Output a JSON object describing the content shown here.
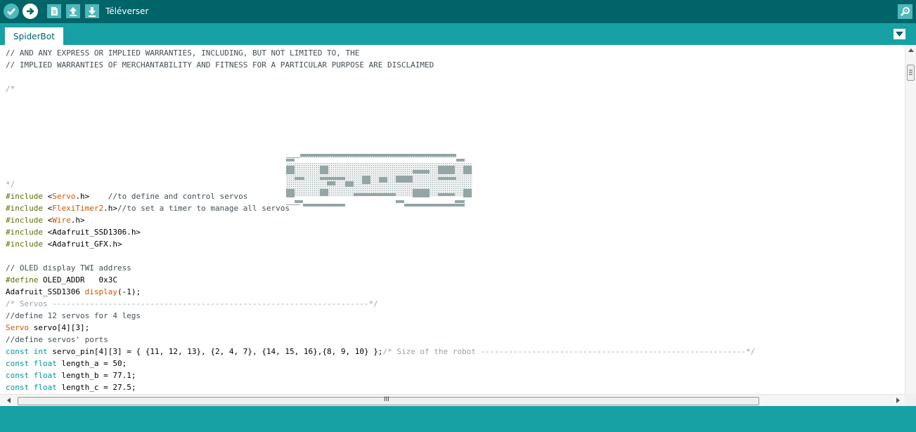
{
  "toolbar": {
    "verify_icon": "checkmark-icon",
    "upload_icon": "arrow-right-icon",
    "new_icon": "document-icon",
    "open_icon": "arrow-up-icon",
    "save_icon": "arrow-down-icon",
    "hover_label": "Téléverser",
    "serial_icon": "magnifier-icon"
  },
  "tabs": [
    {
      "label": "SpiderBot"
    }
  ],
  "tab_menu_icon": "triangle-down-icon",
  "editor": {
    "logo_icon": "ascii-art-banner",
    "lines": [
      "// AND ANY EXPRESS OR IMPLIED WARRANTIES, INCLUDING, BUT NOT LIMITED TO, THE",
      "// IMPLIED WARRANTIES OF MERCHANTABILITY AND FITNESS FOR A PARTICULAR PURPOSE ARE DISCLAIMED",
      "",
      "/*",
      "",
      "",
      "",
      "",
      "",
      "",
      "",
      "*/",
      "#include <Servo.h>    //to define and control servos",
      "#include <FlexiTimer2.h>//to set a timer to manage all servos",
      "#include <Wire.h>",
      "#include <Adafruit_SSD1306.h>",
      "#include <Adafruit_GFX.h>",
      "",
      "// OLED display TWI address",
      "#define OLED_ADDR   0x3C",
      "Adafruit_SSD1306 display(-1);",
      "/* Servos --------------------------------------------------------------------*/",
      "//define 12 servos for 4 legs",
      "Servo servo[4][3];",
      "//define servos' ports",
      "const int servo_pin[4][3] = { {11, 12, 13}, {2, 4, 7}, {14, 15, 16},{8, 9, 10} };/* Size of the robot ---------------------------------------------------------*/",
      "const float length_a = 50;",
      "const float length_b = 77.1;",
      "const float length_c = 27.5;"
    ]
  },
  "scrollbar": {
    "grip_text": "III",
    "left_arrow_icon": "arrow-left-icon",
    "right_arrow_icon": "arrow-right-icon",
    "up_arrow_icon": "arrow-up-icon"
  },
  "colors": {
    "toolbar": "#006468",
    "tabbar": "#17a1a5",
    "button": "#4db7bb",
    "keyword": "#d35400",
    "type": "#00979c",
    "preprocessor": "#5e6d03",
    "comment": "#434f54"
  }
}
